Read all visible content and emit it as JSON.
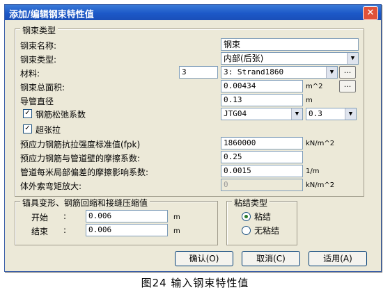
{
  "window": {
    "title": "添加/编辑钢束特性值",
    "close_glyph": "✕"
  },
  "group_steel": {
    "title": "钢束类型",
    "name_label": "钢束名称:",
    "name_value": "钢束",
    "type_label": "钢束类型:",
    "type_value": "内部(后张)",
    "material_label": "材料:",
    "material_num": "3",
    "material_value": "3: Strand1860",
    "area_label": "钢束总面积:",
    "area_value": "0.00434",
    "area_unit": "m^2",
    "duct_label": "导管直径",
    "duct_value": "0.13",
    "duct_unit": "m",
    "relax_label": "钢筋松弛系数",
    "relax_checked": true,
    "relax_code": "JTG04",
    "relax_value": "0.3",
    "overtension_label": "超张拉",
    "overtension_checked": true,
    "fpk_label": "预应力钢筋抗拉强度标准值(fpk)",
    "fpk_value": "1860000",
    "fpk_unit": "kN/m^2",
    "friction_label": "预应力钢筋与管道壁的摩擦系数:",
    "friction_value": "0.25",
    "wobble_label": "管道每米局部偏差的摩擦影响系数:",
    "wobble_value": "0.0015",
    "wobble_unit": "1/m",
    "external_label": "体外索弯矩放大:",
    "external_value": "0",
    "external_unit": "kN/m^2",
    "ellipsis": "..."
  },
  "group_anchor": {
    "title": "锚具变形、钢筋回缩和接缝压缩值",
    "start_label": "开始",
    "start_sep": ":",
    "start_value": "0.006",
    "end_label": "结束",
    "end_sep": ":",
    "end_value": "0.006",
    "unit": "m"
  },
  "group_bond": {
    "title": "粘结类型",
    "bonded_label": "粘结",
    "unbonded_label": "无粘结",
    "selected": "bonded"
  },
  "buttons": {
    "ok": "确认(O)",
    "cancel": "取消(C)",
    "apply": "适用(A)"
  },
  "caption": "图24  输入钢束特性值",
  "icons": {
    "dropdown": "chevron-down-icon",
    "check": "checkmark-icon"
  }
}
